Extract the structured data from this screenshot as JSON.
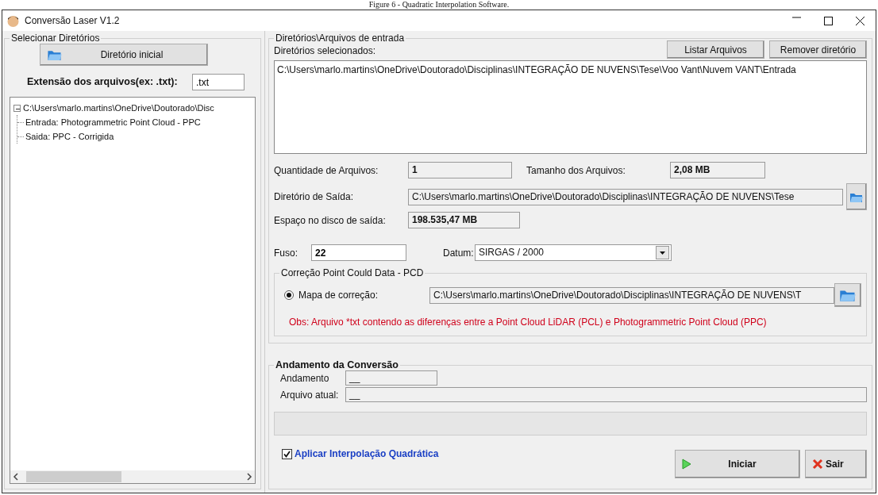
{
  "caption": "Figure 6 - Quadratic Interpolation Software.",
  "window": {
    "title": "Conversão Laser V1.2"
  },
  "left_panel": {
    "title": "Selecionar Diretórios",
    "initial_dir_button": "Diretório inicial",
    "extension": {
      "label": "Extensão dos arquivos(ex: .txt):",
      "value": ".txt"
    },
    "tree": [
      {
        "label": "C:\\Users\\marlo.martins\\OneDrive\\Doutorado\\Disc",
        "expanded": true,
        "children": [
          {
            "label": "Entrada: Photogrammetric Point Cloud - PPC"
          },
          {
            "label": "Saida: PPC - Corrigida"
          }
        ]
      }
    ]
  },
  "input_panel": {
    "title": "Diretórios\\Arquivos de entrada",
    "selected_label": "Diretórios selecionados:",
    "buttons": [
      "Listar Arquivos",
      "Remover diretório"
    ],
    "selected_dirs": [
      "C:\\Users\\marlo.martins\\OneDrive\\Doutorado\\Disciplinas\\INTEGRAÇÃO DE NUVENS\\Tese\\Voo Vant\\Nuvem VANT\\Entrada"
    ],
    "file_count": {
      "label": "Quantidade de Arquivos:",
      "value": "1"
    },
    "file_size": {
      "label": "Tamanho dos Arquivos:",
      "value": "2,08 MB"
    },
    "output_dir": {
      "label": "Diretório de Saída:",
      "value": "C:\\Users\\marlo.martins\\OneDrive\\Doutorado\\Disciplinas\\INTEGRAÇÃO DE NUVENS\\Tese"
    },
    "disk_space": {
      "label": "Espaço no disco de saída:",
      "value": "198.535,47 MB"
    },
    "fuso": {
      "label": "Fuso:",
      "value": "22"
    },
    "datum": {
      "label": "Datum:",
      "value": "SIRGAS / 2000"
    }
  },
  "correction": {
    "title": "Correção Point Could Data - PCD",
    "option": {
      "label": "Mapa de correção:",
      "selected": true
    },
    "path": "C:\\Users\\marlo.martins\\OneDrive\\Doutorado\\Disciplinas\\INTEGRAÇÃO DE NUVENS\\T",
    "note": "Obs: Arquivo *txt contendo as diferenças entre a Point Cloud LiDAR (PCL) e Photogrammetric Point Cloud (PPC)"
  },
  "progress": {
    "title": "Andamento da Conversão",
    "status": {
      "label": "Andamento",
      "value": "__"
    },
    "current_file": {
      "label": "Arquivo atual:",
      "value": "__"
    }
  },
  "quadratic": {
    "label": "Aplicar Interpolação Quadrática",
    "checked": true
  },
  "actions": [
    {
      "label": "Iniciar",
      "kind": "start"
    },
    {
      "label": "Sair",
      "kind": "exit"
    }
  ]
}
